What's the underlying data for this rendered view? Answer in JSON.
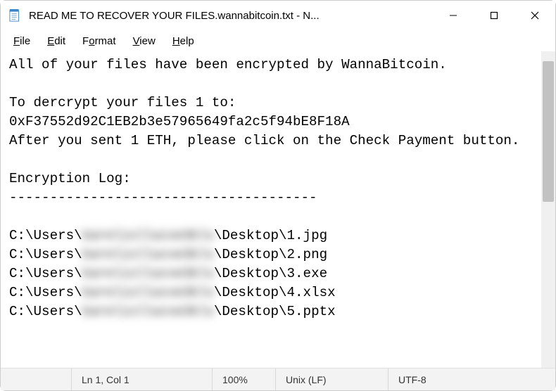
{
  "titlebar": {
    "title": "READ ME TO RECOVER YOUR FILES.wannabitcoin.txt - N..."
  },
  "menu": {
    "items": [
      {
        "label": "File",
        "accel": "F"
      },
      {
        "label": "Edit",
        "accel": "E"
      },
      {
        "label": "Format",
        "accel": "o"
      },
      {
        "label": "View",
        "accel": "V"
      },
      {
        "label": "Help",
        "accel": "H"
      }
    ]
  },
  "document": {
    "line1": "All of your files have been encrypted by WannaBitcoin.",
    "blank1": "",
    "line2": "To dercrypt your files 1 to:",
    "address": "0xF37552d92C1EB2b3e57965649fa2c5f94bE8F18A",
    "line3": "After you sent 1 ETH, please click on the Check Payment button.",
    "blank2": "",
    "loghdr": "Encryption Log:",
    "sep": "--------------------------------------",
    "blank3": "",
    "log": [
      {
        "pre": "C:\\Users\\",
        "mid": "karelisllucve3kls",
        "post": "\\Desktop\\1.jpg"
      },
      {
        "pre": "C:\\Users\\",
        "mid": "karelisllucve3kls",
        "post": "\\Desktop\\2.png"
      },
      {
        "pre": "C:\\Users\\",
        "mid": "karelisllucve3kls",
        "post": "\\Desktop\\3.exe"
      },
      {
        "pre": "C:\\Users\\",
        "mid": "karelisllucve3kls",
        "post": "\\Desktop\\4.xlsx"
      },
      {
        "pre": "C:\\Users\\",
        "mid": "karelisllucve3kls",
        "post": "\\Desktop\\5.pptx"
      }
    ]
  },
  "status": {
    "position": "Ln 1, Col 1",
    "zoom": "100%",
    "eol": "Unix (LF)",
    "encoding": "UTF-8"
  }
}
